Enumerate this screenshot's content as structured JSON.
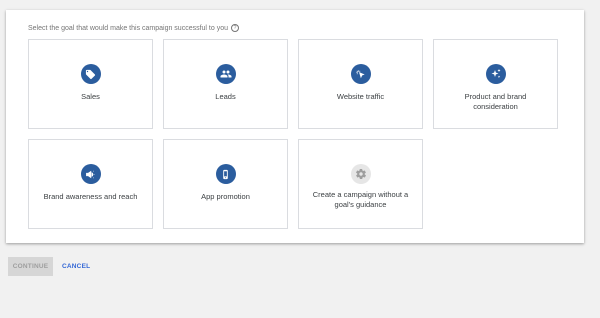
{
  "prompt": {
    "text": "Select the goal that would make this campaign successful to you",
    "help_icon": "help-circle-icon"
  },
  "goals": [
    {
      "label": "Sales",
      "icon": "tag-icon"
    },
    {
      "label": "Leads",
      "icon": "people-icon"
    },
    {
      "label": "Website traffic",
      "icon": "cursor-click-icon"
    },
    {
      "label": "Product and brand consideration",
      "icon": "sparkle-icon"
    },
    {
      "label": "Brand awareness and reach",
      "icon": "megaphone-icon"
    },
    {
      "label": "App promotion",
      "icon": "phone-icon"
    },
    {
      "label": "Create a campaign without a goal's guidance",
      "icon": "gear-icon"
    }
  ],
  "footer": {
    "continue_label": "CONTINUE",
    "cancel_label": "CANCEL"
  },
  "colors": {
    "icon_bg": "#2b5d9e",
    "link": "#3367d6",
    "disabled_btn_bg": "#d6d6d6"
  }
}
